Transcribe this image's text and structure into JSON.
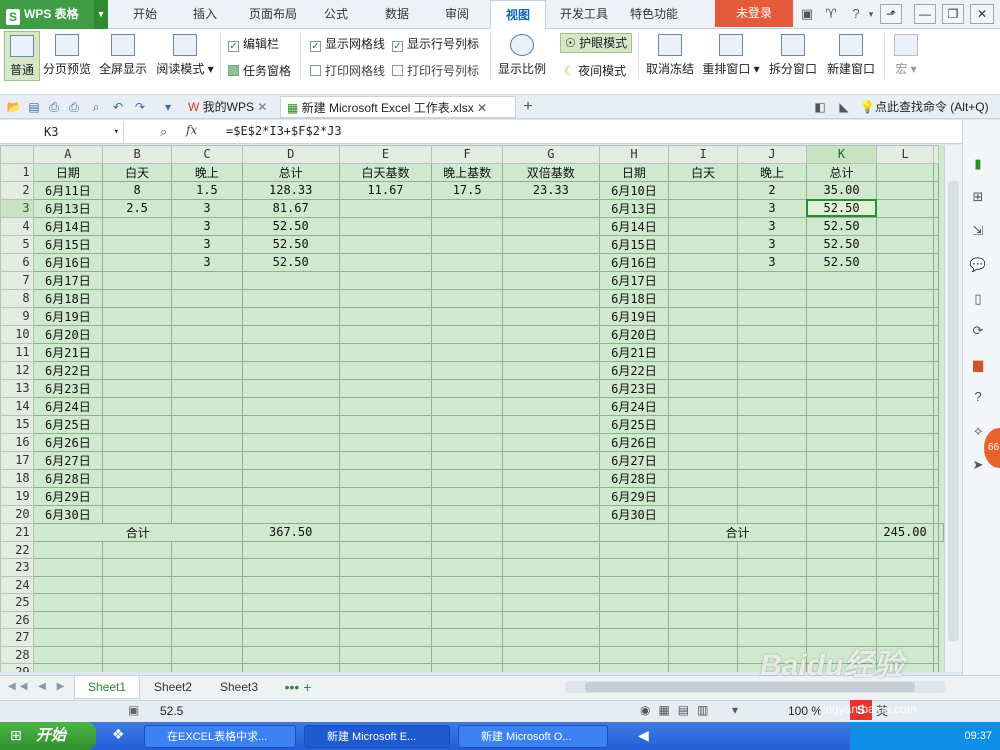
{
  "app": {
    "name": "WPS 表格",
    "login": "未登录"
  },
  "tabs": [
    "开始",
    "插入",
    "页面布局",
    "公式",
    "数据",
    "审阅",
    "视图",
    "开发工具",
    "特色功能"
  ],
  "ribbon": {
    "buttons": [
      "普通",
      "分页预览",
      "全屏显示",
      "阅读模式",
      "显示比例",
      "护眼模式",
      "夜间模式",
      "取消冻结",
      "重排窗口",
      "拆分窗口",
      "新建窗口",
      "宏"
    ],
    "checks": {
      "edit_bar": "编辑栏",
      "task_pane": "任务窗格",
      "show_grid": "显示网格线",
      "show_headers": "显示行号列标",
      "print_grid": "打印网格线",
      "print_headers": "打印行号列标"
    }
  },
  "docbar": {
    "tab1": "我的WPS",
    "tab2": "新建 Microsoft Excel 工作表.xlsx",
    "find": "点此查找命令 (Alt+Q)"
  },
  "formula": {
    "cell": "K3",
    "fx": "fx",
    "value": "=$E$2*I3+$F$2*J3"
  },
  "columns": [
    "A",
    "B",
    "C",
    "D",
    "E",
    "F",
    "G",
    "H",
    "I",
    "J",
    "K",
    "L"
  ],
  "rows": [
    [
      "日期",
      "白天",
      "晚上",
      "总计",
      "白天基数",
      "晚上基数",
      "双倍基数",
      "日期",
      "白天",
      "晚上",
      "总计",
      ""
    ],
    [
      "6月11日",
      "8",
      "1.5",
      "128.33",
      "11.67",
      "17.5",
      "23.33",
      "6月10日",
      "",
      "2",
      "35.00",
      ""
    ],
    [
      "6月13日",
      "2.5",
      "3",
      "81.67",
      "",
      "",
      "",
      "6月13日",
      "",
      "3",
      "52.50",
      ""
    ],
    [
      "6月14日",
      "",
      "3",
      "52.50",
      "",
      "",
      "",
      "6月14日",
      "",
      "3",
      "52.50",
      ""
    ],
    [
      "6月15日",
      "",
      "3",
      "52.50",
      "",
      "",
      "",
      "6月15日",
      "",
      "3",
      "52.50",
      ""
    ],
    [
      "6月16日",
      "",
      "3",
      "52.50",
      "",
      "",
      "",
      "6月16日",
      "",
      "3",
      "52.50",
      ""
    ],
    [
      "6月17日",
      "",
      "",
      "",
      "",
      "",
      "",
      "6月17日",
      "",
      "",
      "",
      ""
    ],
    [
      "6月18日",
      "",
      "",
      "",
      "",
      "",
      "",
      "6月18日",
      "",
      "",
      "",
      ""
    ],
    [
      "6月19日",
      "",
      "",
      "",
      "",
      "",
      "",
      "6月19日",
      "",
      "",
      "",
      ""
    ],
    [
      "6月20日",
      "",
      "",
      "",
      "",
      "",
      "",
      "6月20日",
      "",
      "",
      "",
      ""
    ],
    [
      "6月21日",
      "",
      "",
      "",
      "",
      "",
      "",
      "6月21日",
      "",
      "",
      "",
      ""
    ],
    [
      "6月22日",
      "",
      "",
      "",
      "",
      "",
      "",
      "6月22日",
      "",
      "",
      "",
      ""
    ],
    [
      "6月23日",
      "",
      "",
      "",
      "",
      "",
      "",
      "6月23日",
      "",
      "",
      "",
      ""
    ],
    [
      "6月24日",
      "",
      "",
      "",
      "",
      "",
      "",
      "6月24日",
      "",
      "",
      "",
      ""
    ],
    [
      "6月25日",
      "",
      "",
      "",
      "",
      "",
      "",
      "6月25日",
      "",
      "",
      "",
      ""
    ],
    [
      "6月26日",
      "",
      "",
      "",
      "",
      "",
      "",
      "6月26日",
      "",
      "",
      "",
      ""
    ],
    [
      "6月27日",
      "",
      "",
      "",
      "",
      "",
      "",
      "6月27日",
      "",
      "",
      "",
      ""
    ],
    [
      "6月28日",
      "",
      "",
      "",
      "",
      "",
      "",
      "6月28日",
      "",
      "",
      "",
      ""
    ],
    [
      "6月29日",
      "",
      "",
      "",
      "",
      "",
      "",
      "6月29日",
      "",
      "",
      "",
      ""
    ],
    [
      "6月30日",
      "",
      "",
      "",
      "",
      "",
      "",
      "6月30日",
      "",
      "",
      "",
      ""
    ]
  ],
  "totals": {
    "label": "合计",
    "left": "367.50",
    "right": "245.00"
  },
  "sheets": [
    "Sheet1",
    "Sheet2",
    "Sheet3"
  ],
  "status": {
    "value": "52.5",
    "zoom": "100 %"
  },
  "taskbar": {
    "start": "开始",
    "tasks": [
      "在EXCEL表格中求...",
      "新建 Microsoft E...",
      "新建 Microsoft O..."
    ],
    "time": "09:37"
  },
  "watermark": {
    "brand": "Baidu经验",
    "url": "jingyan.baidu.com"
  }
}
